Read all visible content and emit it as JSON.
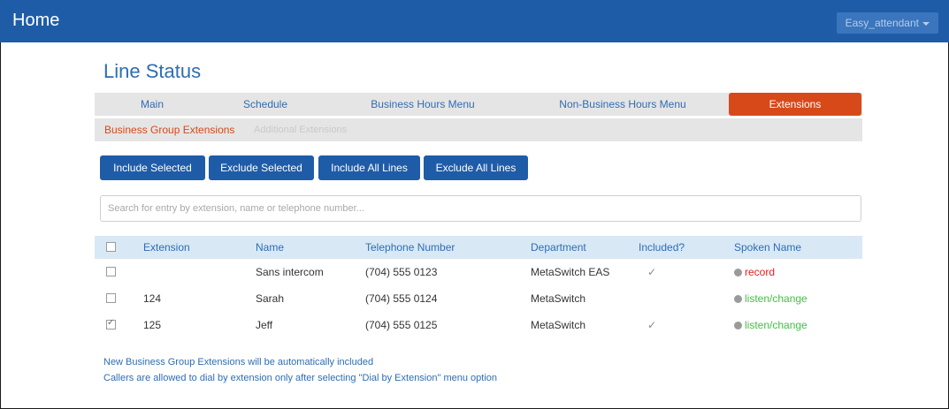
{
  "header": {
    "home_label": "Home",
    "user_menu": "Easy_attendant"
  },
  "page": {
    "title": "Line Status"
  },
  "tabs": [
    {
      "label": "Main"
    },
    {
      "label": "Schedule"
    },
    {
      "label": "Business Hours Menu"
    },
    {
      "label": "Non-Business Hours Menu"
    },
    {
      "label": "Extensions",
      "active": true
    }
  ],
  "subtabs": [
    {
      "label": "Business Group Extensions",
      "active": true
    },
    {
      "label": "Additional Extensions"
    }
  ],
  "actions": [
    {
      "label": "Include Selected"
    },
    {
      "label": "Exclude Selected"
    },
    {
      "label": "Include All Lines"
    },
    {
      "label": "Exclude All Lines"
    }
  ],
  "search": {
    "placeholder": "Search for entry by extension, name or telephone number...",
    "value": ""
  },
  "table": {
    "headers": [
      "Extension",
      "Name",
      "Telephone Number",
      "Department",
      "Included?",
      "Spoken Name"
    ],
    "rows": [
      {
        "checked": false,
        "extension": "",
        "name": "Sans intercom",
        "phone": "(704) 555 0123",
        "department": "MetaSwitch EAS",
        "included": "✓",
        "spoken": "record"
      },
      {
        "checked": false,
        "extension": "124",
        "name": "Sarah",
        "phone": "(704) 555 0124",
        "department": "MetaSwitch",
        "included": "",
        "spoken": "listen/change"
      },
      {
        "checked": true,
        "extension": "125",
        "name": "Jeff",
        "phone": "(704) 555 0125",
        "department": "MetaSwitch",
        "included": "✓",
        "spoken": "listen/change"
      }
    ]
  },
  "notes": [
    "New Business Group Extensions will be automatically included",
    "Callers are allowed to dial by extension only after selecting \"Dial by Extension\" menu option"
  ],
  "colors": {
    "header_bg": "#1f5ca8",
    "active_tab": "#d8491a",
    "link_blue": "#2e6db4",
    "record_red": "#e02020",
    "listen_green": "#3ec43e"
  }
}
